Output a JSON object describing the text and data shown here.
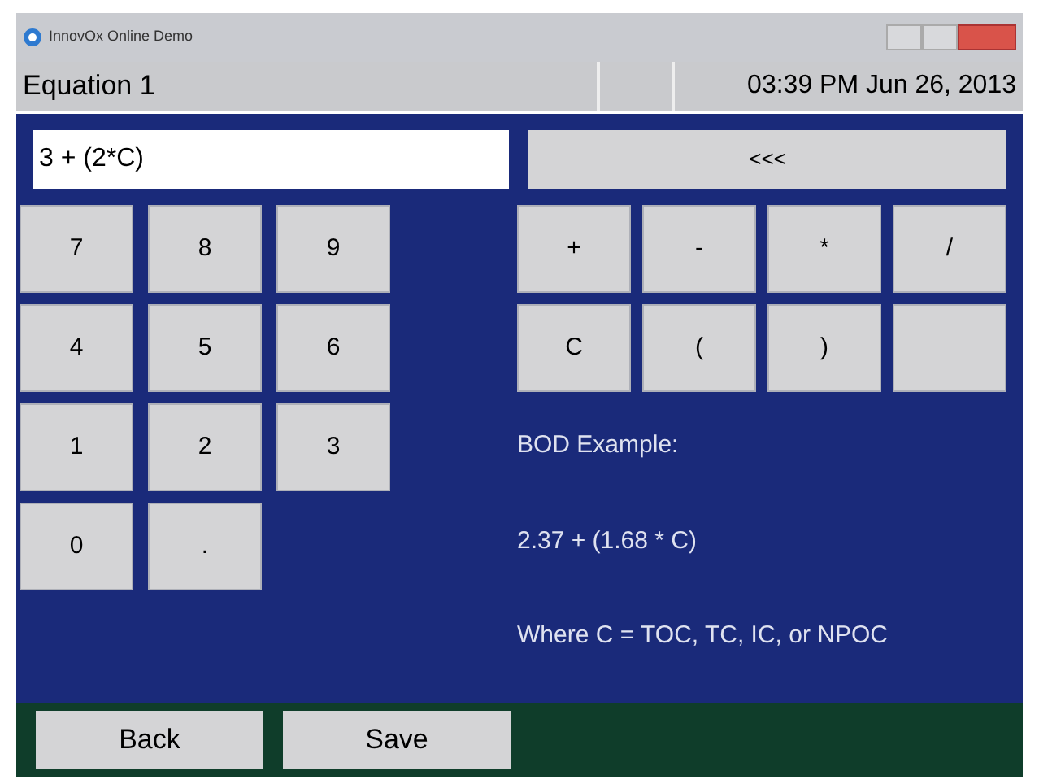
{
  "window": {
    "title": "InnovOx Online Demo"
  },
  "header": {
    "title": "Equation 1",
    "datetime": "03:39 PM Jun 26, 2013"
  },
  "expression": {
    "value": "3 + (2*C)"
  },
  "backspace": {
    "label": "<<<"
  },
  "keypad": [
    {
      "label": "7"
    },
    {
      "label": "8"
    },
    {
      "label": "9"
    },
    {
      "label": "4"
    },
    {
      "label": "5"
    },
    {
      "label": "6"
    },
    {
      "label": "1"
    },
    {
      "label": "2"
    },
    {
      "label": "3"
    },
    {
      "label": "0"
    },
    {
      "label": "."
    }
  ],
  "operators": [
    {
      "kind": "key",
      "label": "+"
    },
    {
      "kind": "key",
      "label": "-"
    },
    {
      "kind": "key",
      "label": "*"
    },
    {
      "kind": "key",
      "label": "/"
    },
    {
      "kind": "key",
      "label": "C"
    },
    {
      "kind": "key",
      "label": "("
    },
    {
      "kind": "key",
      "label": ")"
    },
    {
      "kind": "blank"
    }
  ],
  "notes": [
    "BOD Example:",
    "2.37 + (1.68 * C)",
    "Where C = TOC, TC, IC, or NPOC"
  ],
  "footer_buttons": [
    "Back",
    "Save"
  ]
}
